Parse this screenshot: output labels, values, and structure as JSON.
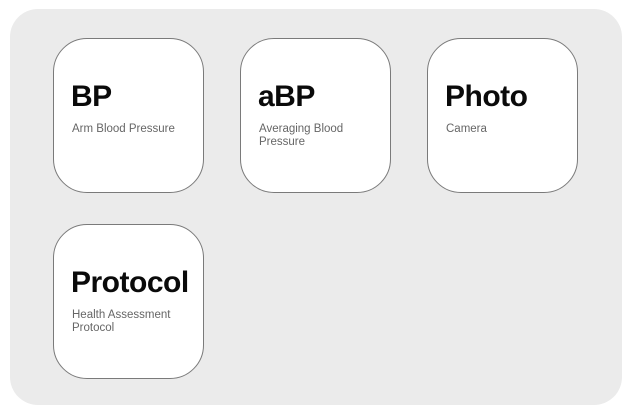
{
  "tiles": [
    {
      "title": "BP",
      "subtitle": "Arm Blood Pressure"
    },
    {
      "title": "aBP",
      "subtitle": "Averaging Blood Pressure"
    },
    {
      "title": "Photo",
      "subtitle": "Camera"
    },
    {
      "title": "Protocol",
      "subtitle": "Health Assessment Protocol"
    }
  ],
  "colors": {
    "panel_background": "#ebebeb",
    "tile_background": "#ffffff",
    "tile_border": "#7a7a7a",
    "title_text": "#0a0a0a",
    "subtitle_text": "#666666"
  }
}
